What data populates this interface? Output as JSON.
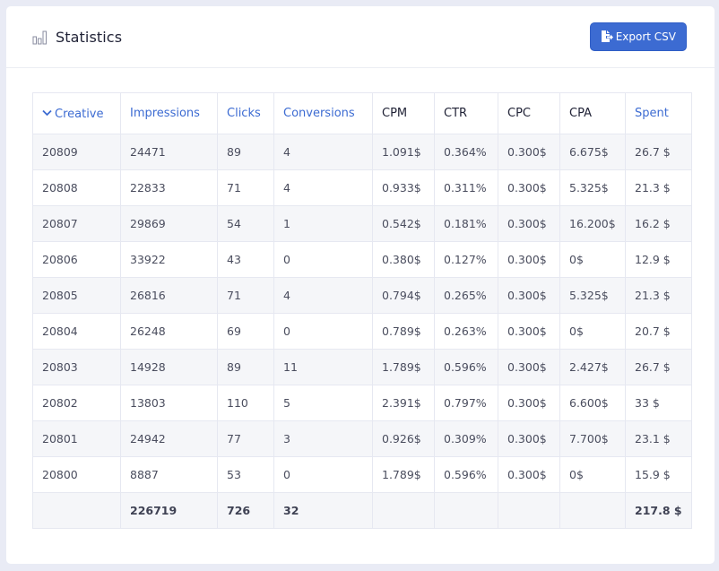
{
  "header": {
    "title": "Statistics",
    "title_icon": "bar-chart-icon",
    "export_button": {
      "label": "Export CSV",
      "icon": "file-export-icon"
    }
  },
  "colors": {
    "accent": "#3c6bd2",
    "page_background": "#e9ebf5",
    "stripe": "#f5f6f9"
  },
  "table": {
    "sort": {
      "column": "Creative",
      "direction": "desc",
      "icon": "chevron-down-icon"
    },
    "columns": [
      {
        "label": "Creative",
        "sortable": true
      },
      {
        "label": "Impressions",
        "sortable": true
      },
      {
        "label": "Clicks",
        "sortable": true
      },
      {
        "label": "Conversions",
        "sortable": true
      },
      {
        "label": "CPM",
        "sortable": false
      },
      {
        "label": "CTR",
        "sortable": false
      },
      {
        "label": "CPC",
        "sortable": false
      },
      {
        "label": "CPA",
        "sortable": false
      },
      {
        "label": "Spent",
        "sortable": true
      }
    ],
    "rows": [
      [
        "20809",
        "24471",
        "89",
        "4",
        "1.091$",
        "0.364%",
        "0.300$",
        "6.675$",
        "26.7 $"
      ],
      [
        "20808",
        "22833",
        "71",
        "4",
        "0.933$",
        "0.311%",
        "0.300$",
        "5.325$",
        "21.3 $"
      ],
      [
        "20807",
        "29869",
        "54",
        "1",
        "0.542$",
        "0.181%",
        "0.300$",
        "16.200$",
        "16.2 $"
      ],
      [
        "20806",
        "33922",
        "43",
        "0",
        "0.380$",
        "0.127%",
        "0.300$",
        "0$",
        "12.9 $"
      ],
      [
        "20805",
        "26816",
        "71",
        "4",
        "0.794$",
        "0.265%",
        "0.300$",
        "5.325$",
        "21.3 $"
      ],
      [
        "20804",
        "26248",
        "69",
        "0",
        "0.789$",
        "0.263%",
        "0.300$",
        "0$",
        "20.7 $"
      ],
      [
        "20803",
        "14928",
        "89",
        "11",
        "1.789$",
        "0.596%",
        "0.300$",
        "2.427$",
        "26.7 $"
      ],
      [
        "20802",
        "13803",
        "110",
        "5",
        "2.391$",
        "0.797%",
        "0.300$",
        "6.600$",
        "33 $"
      ],
      [
        "20801",
        "24942",
        "77",
        "3",
        "0.926$",
        "0.309%",
        "0.300$",
        "7.700$",
        "23.1 $"
      ],
      [
        "20800",
        "8887",
        "53",
        "0",
        "1.789$",
        "0.596%",
        "0.300$",
        "0$",
        "15.9 $"
      ]
    ],
    "totals": [
      "",
      "226719",
      "726",
      "32",
      "",
      "",
      "",
      "",
      "217.8 $"
    ]
  }
}
